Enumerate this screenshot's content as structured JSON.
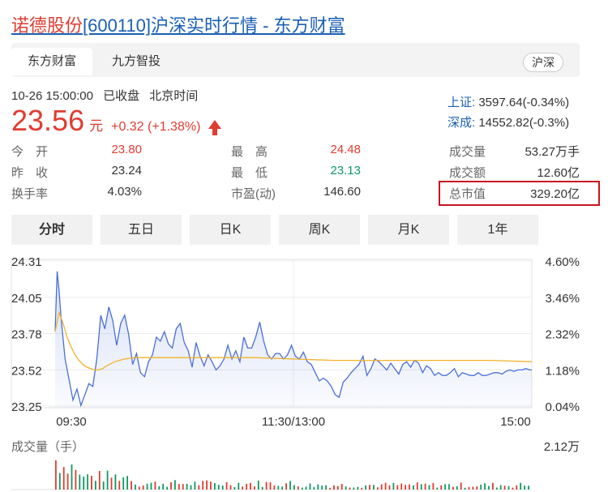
{
  "header": {
    "stock_name": "诺德股份",
    "title_rest": "[600110]沪深实时行情 - 东方财富"
  },
  "tabs": {
    "items": [
      "东方财富",
      "九方智投"
    ],
    "exchange_toggle": "沪深"
  },
  "quote": {
    "datetime": "10-26 15:00:00",
    "market_state": "已收盘",
    "timezone": "北京时间",
    "price": "23.56",
    "unit": "元",
    "change": "+0.32 (+1.38%)",
    "direction": "up"
  },
  "indices": [
    {
      "label": "上证:",
      "value": "3597.64(-0.34%)"
    },
    {
      "label": "深成:",
      "value": "14552.82(-0.3%)"
    }
  ],
  "stats": {
    "open_label": "今　开",
    "open": "23.80",
    "prev_close_label": "昨　收",
    "prev_close": "23.24",
    "turnover_rate_label": "换手率",
    "turnover_rate": "4.03%",
    "high_label": "最　高",
    "high": "24.48",
    "low_label": "最　低",
    "low": "23.13",
    "pe_label": "市盈(动)",
    "pe": "146.60",
    "volume_label": "成交量",
    "volume": "53.27万手",
    "amount_label": "成交额",
    "amount": "12.60亿",
    "market_cap_label": "总市值",
    "market_cap": "329.20亿"
  },
  "period_tabs": [
    "分时",
    "五日",
    "日K",
    "周K",
    "月K",
    "1年"
  ],
  "active_period": "分时",
  "colors": {
    "up": "#e03c31",
    "down": "#0e9a64",
    "link": "#1a5fb4",
    "price_line": "#4a6fd8",
    "avg_line": "#f0b12a",
    "highlight_box": "#c8151e"
  },
  "chart_data": {
    "type": "line",
    "y_left_ticks": [
      "24.31",
      "24.05",
      "23.78",
      "23.52",
      "23.25"
    ],
    "y_right_ticks": [
      "4.60%",
      "3.46%",
      "2.32%",
      "1.18%",
      "0.04%"
    ],
    "ylim": [
      23.25,
      24.31
    ],
    "x_ticks": [
      "09:30",
      "11:30/13:00",
      "15:00"
    ],
    "x_range": [
      0,
      240
    ],
    "volume_label": "成交量（手）",
    "volume_max_label": "2.12万",
    "series": [
      {
        "x": [
          0,
          1,
          2,
          3,
          5,
          7,
          9,
          11,
          13,
          15,
          17,
          19,
          21,
          23,
          25,
          27,
          29,
          31,
          33,
          35,
          37,
          39,
          41,
          43,
          45,
          47,
          49,
          51,
          53,
          55,
          57,
          59,
          61,
          63,
          65,
          67,
          69,
          71,
          73,
          75,
          77,
          79,
          81,
          83,
          85,
          87,
          89,
          91,
          93,
          95,
          97,
          99,
          101,
          103,
          105,
          107,
          109,
          111,
          113,
          115,
          117,
          119,
          121,
          123,
          125,
          127,
          129,
          131,
          133,
          135,
          137,
          139,
          141,
          143,
          145,
          147,
          149,
          151,
          153,
          155,
          157,
          159,
          161,
          163,
          165,
          167,
          169,
          171,
          173,
          175,
          177,
          179,
          181,
          183,
          185,
          187,
          189,
          191,
          193,
          195,
          197,
          199,
          201,
          203,
          205,
          207,
          209,
          211,
          213,
          215,
          217,
          219,
          221,
          223,
          225,
          227,
          229,
          231,
          233,
          235,
          237,
          239,
          240
        ],
        "values": [
          23.8,
          24.24,
          24.1,
          23.9,
          23.6,
          23.45,
          23.3,
          23.38,
          23.26,
          23.34,
          23.42,
          23.4,
          23.6,
          23.92,
          23.82,
          23.98,
          23.88,
          23.7,
          23.86,
          23.92,
          23.78,
          23.56,
          23.64,
          23.5,
          23.47,
          23.58,
          23.63,
          23.76,
          23.73,
          23.8,
          23.71,
          23.68,
          23.82,
          23.86,
          23.72,
          23.66,
          23.54,
          23.72,
          23.62,
          23.55,
          23.63,
          23.58,
          23.52,
          23.55,
          23.6,
          23.7,
          23.6,
          23.66,
          23.58,
          23.76,
          23.68,
          23.68,
          23.76,
          23.87,
          23.73,
          23.63,
          23.6,
          23.64,
          23.64,
          23.6,
          23.63,
          23.7,
          23.62,
          23.6,
          23.65,
          23.58,
          23.56,
          23.5,
          23.44,
          23.46,
          23.44,
          23.4,
          23.34,
          23.32,
          23.43,
          23.46,
          23.5,
          23.53,
          23.56,
          23.62,
          23.48,
          23.53,
          23.6,
          23.58,
          23.55,
          23.52,
          23.57,
          23.53,
          23.49,
          23.56,
          23.58,
          23.54,
          23.59,
          23.57,
          23.5,
          23.55,
          23.53,
          23.48,
          23.5,
          23.48,
          23.48,
          23.5,
          23.53,
          23.47,
          23.5,
          23.49,
          23.48,
          23.48,
          23.5,
          23.48,
          23.48,
          23.49,
          23.5,
          23.5,
          23.49,
          23.51,
          23.52,
          23.51,
          23.52,
          23.52,
          23.53,
          23.52,
          23.52
        ]
      },
      {
        "x": [
          0,
          2,
          4,
          6,
          8,
          10,
          12,
          14,
          16,
          18,
          20,
          22,
          24,
          26,
          30,
          35,
          40,
          50,
          60,
          80,
          100,
          120,
          140,
          160,
          180,
          200,
          220,
          240
        ],
        "values": [
          23.8,
          23.94,
          23.86,
          23.76,
          23.69,
          23.63,
          23.59,
          23.56,
          23.54,
          23.53,
          23.52,
          23.52,
          23.53,
          23.55,
          23.58,
          23.6,
          23.61,
          23.61,
          23.61,
          23.61,
          23.61,
          23.6,
          23.59,
          23.59,
          23.59,
          23.59,
          23.59,
          23.58
        ]
      }
    ]
  }
}
